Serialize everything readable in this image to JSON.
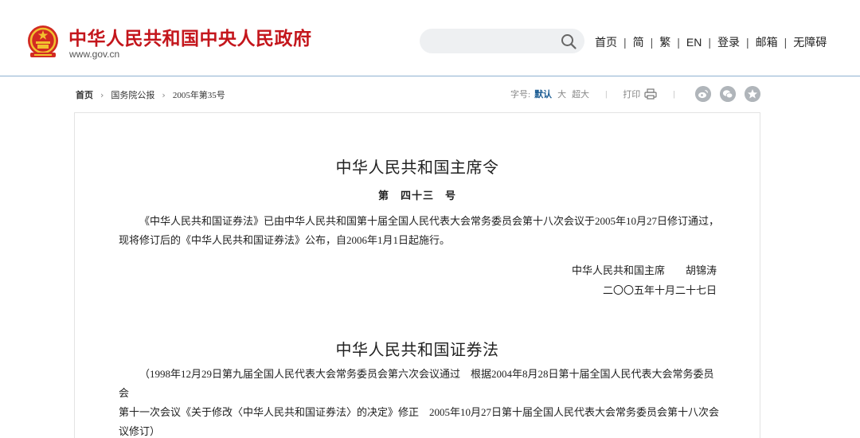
{
  "header": {
    "site_title": "中华人民共和国中央人民政府",
    "site_url": "www.gov.cn",
    "search_placeholder": "",
    "nav": [
      "首页",
      "简",
      "繁",
      "EN",
      "登录",
      "邮箱",
      "无障碍"
    ]
  },
  "breadcrumb": [
    "首页",
    "国务院公报",
    "2005年第35号"
  ],
  "toolbar": {
    "font_size_label": "字号:",
    "font_sizes": [
      "默认",
      "大",
      "超大"
    ],
    "print_label": "打印"
  },
  "share_icons": [
    "weibo-icon",
    "wechat-icon",
    "favorite-icon"
  ],
  "document": {
    "decree_title": "中华人民共和国主席令",
    "decree_number": "第　四十三　号",
    "decree_body_line1": "《中华人民共和国证券法》已由中华人民共和国第十届全国人民代表大会常务委员会第十八次会议于2005年10月27日修订通过，",
    "decree_body_line2": "现将修订后的《中华人民共和国证券法》公布，自2006年1月1日起施行。",
    "signer": "中华人民共和国主席　　胡锦涛",
    "sign_date": "二〇〇五年十月二十七日",
    "law_title": "中华人民共和国证券法",
    "law_note_line1": "（1998年12月29日第九届全国人民代表大会常务委员会第六次会议通过　根据2004年8月28日第十届全国人民代表大会常务委员会",
    "law_note_line2": "第十一次会议《关于修改〈中华人民共和国证券法〉的决定》修正　2005年10月27日第十届全国人民代表大会常务委员会第十八次会",
    "law_note_line3": "议修订）"
  },
  "colors": {
    "brand_red": "#c4161c",
    "link_blue": "#1b5c93",
    "divider_blue": "#8fb1d1"
  }
}
